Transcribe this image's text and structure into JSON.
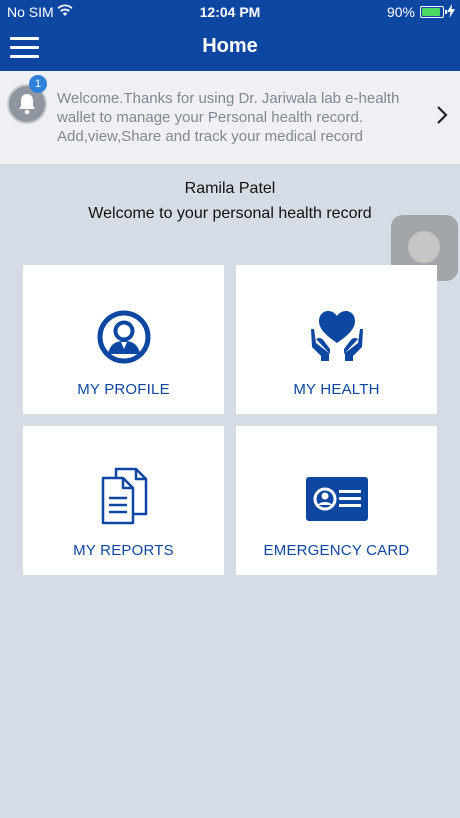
{
  "status_bar": {
    "carrier": "No SIM",
    "time": "12:04 PM",
    "battery_pct": "90%",
    "battery_level": 0.9,
    "battery_color": "#4cd964"
  },
  "header": {
    "title": "Home",
    "menu_icon": "hamburger-menu-icon",
    "color": "#0d47a1"
  },
  "notification": {
    "badge_count": "1",
    "message": "Welcome.Thanks for using Dr. Jariwala lab e-health wallet to manage your Personal health record. Add,view,Share and track your medical record",
    "icon": "bell-icon"
  },
  "user": {
    "name": "Ramila Patel",
    "welcome": "Welcome to your personal health record"
  },
  "tiles": [
    {
      "label": "MY PROFILE",
      "icon": "profile-icon"
    },
    {
      "label": "MY HEALTH",
      "icon": "heart-hands-icon"
    },
    {
      "label": "MY REPORTS",
      "icon": "documents-icon"
    },
    {
      "label": "EMERGENCY CARD",
      "icon": "id-card-icon"
    }
  ],
  "theme": {
    "primary": "#0d47a1",
    "background": "#d5dce5"
  }
}
